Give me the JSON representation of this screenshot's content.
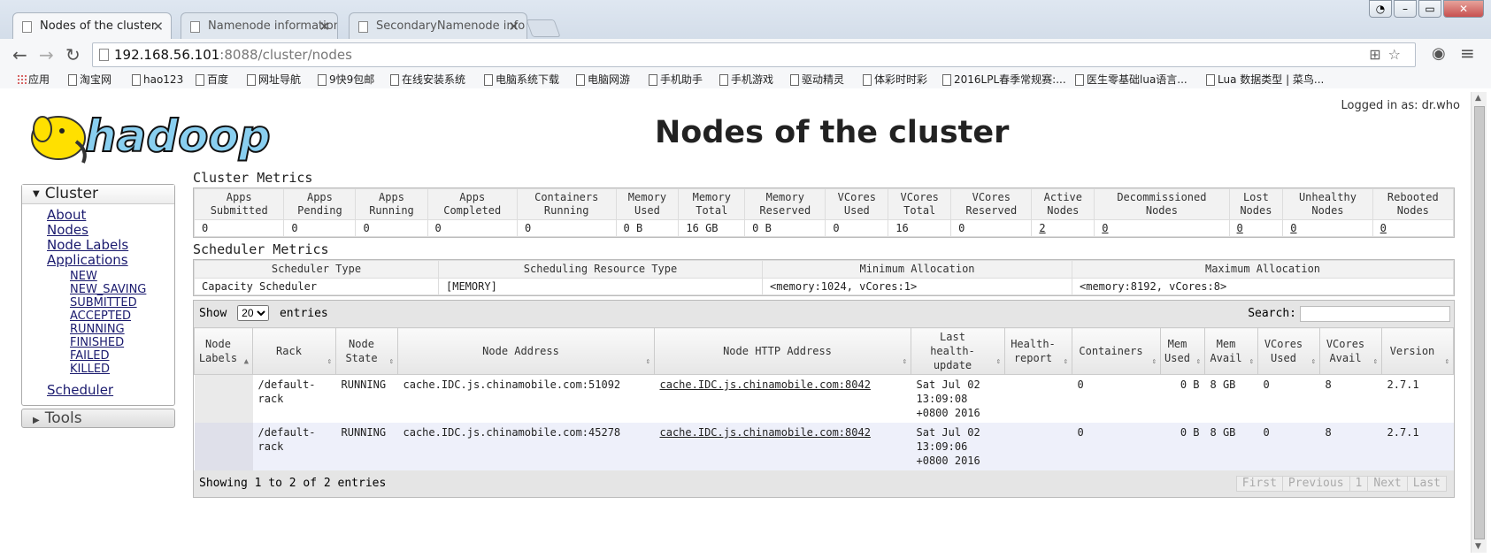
{
  "browser": {
    "tabs": [
      {
        "title": "Nodes of the cluster",
        "close": "✕"
      },
      {
        "title": "Namenode information",
        "close": "✕"
      },
      {
        "title": "SecondaryNamenode info",
        "close": "✕"
      }
    ],
    "url_host": "192.168.56.101",
    "url_path": ":8088/cluster/nodes",
    "bookmarks": [
      "应用",
      "淘宝网",
      "hao123",
      "百度",
      "网址导航",
      "9快9包邮",
      "在线安装系统",
      "电脑系统下载",
      "电脑网游",
      "手机助手",
      "手机游戏",
      "驱动精灵",
      "体彩时时彩",
      "2016LPL春季常规赛:...",
      "医生零基础lua语言...",
      "Lua 数据类型 | 菜鸟..."
    ]
  },
  "header": {
    "logo_text": "hadoop",
    "logged_in": "Logged in as: dr.who",
    "title": "Nodes of the cluster"
  },
  "nav": {
    "cluster_label": "Cluster",
    "items": [
      "About",
      "Nodes",
      "Node Labels",
      "Applications"
    ],
    "app_states": [
      "NEW",
      "NEW_SAVING",
      "SUBMITTED",
      "ACCEPTED",
      "RUNNING",
      "FINISHED",
      "FAILED",
      "KILLED"
    ],
    "scheduler": "Scheduler",
    "tools_label": "Tools"
  },
  "cluster_metrics": {
    "title": "Cluster Metrics",
    "headers": [
      [
        "Apps",
        "Submitted"
      ],
      [
        "Apps",
        "Pending"
      ],
      [
        "Apps",
        "Running"
      ],
      [
        "Apps",
        "Completed"
      ],
      [
        "Containers",
        "Running"
      ],
      [
        "Memory",
        "Used"
      ],
      [
        "Memory",
        "Total"
      ],
      [
        "Memory",
        "Reserved"
      ],
      [
        "VCores",
        "Used"
      ],
      [
        "VCores",
        "Total"
      ],
      [
        "VCores",
        "Reserved"
      ],
      [
        "Active",
        "Nodes"
      ],
      [
        "Decommissioned",
        "Nodes"
      ],
      [
        "Lost",
        "Nodes"
      ],
      [
        "Unhealthy",
        "Nodes"
      ],
      [
        "Rebooted",
        "Nodes"
      ]
    ],
    "values": [
      "0",
      "0",
      "0",
      "0",
      "0",
      "0 B",
      "16 GB",
      "0 B",
      "0",
      "16",
      "0",
      "2",
      "0",
      "0",
      "0",
      "0"
    ]
  },
  "scheduler_metrics": {
    "title": "Scheduler Metrics",
    "headers": [
      "Scheduler Type",
      "Scheduling Resource Type",
      "Minimum Allocation",
      "Maximum Allocation"
    ],
    "values": [
      "Capacity Scheduler",
      "[MEMORY]",
      "<memory:1024, vCores:1>",
      "<memory:8192, vCores:8>"
    ]
  },
  "nodes_table": {
    "show_label": "Show",
    "entries_value": "20",
    "entries_label": "entries",
    "search_label": "Search:",
    "headers": [
      [
        "Node",
        "Labels"
      ],
      [
        "Rack"
      ],
      [
        "Node",
        "State"
      ],
      [
        "Node Address"
      ],
      [
        "Node HTTP Address"
      ],
      [
        "Last health-",
        "update"
      ],
      [
        "Health-",
        "report"
      ],
      [
        "Containers"
      ],
      [
        "Mem",
        "Used"
      ],
      [
        "Mem",
        "Avail"
      ],
      [
        "VCores",
        "Used"
      ],
      [
        "VCores",
        "Avail"
      ],
      [
        "Version"
      ]
    ],
    "rows": [
      {
        "labels": "",
        "rack": [
          "/default-",
          "rack"
        ],
        "state": "RUNNING",
        "address": "cache.IDC.js.chinamobile.com:51092",
        "http": "cache.IDC.js.chinamobile.com:8042",
        "health": [
          "Sat Jul 02",
          "13:09:08",
          "+0800 2016"
        ],
        "report": "",
        "containers": "0",
        "mem_used": "0 B",
        "mem_avail": "8 GB",
        "vc_used": "0",
        "vc_avail": "8",
        "version": "2.7.1"
      },
      {
        "labels": "",
        "rack": [
          "/default-",
          "rack"
        ],
        "state": "RUNNING",
        "address": "cache.IDC.js.chinamobile.com:45278",
        "http": "cache.IDC.js.chinamobile.com:8042",
        "health": [
          "Sat Jul 02",
          "13:09:06",
          "+0800 2016"
        ],
        "report": "",
        "containers": "0",
        "mem_used": "0 B",
        "mem_avail": "8 GB",
        "vc_used": "0",
        "vc_avail": "8",
        "version": "2.7.1"
      }
    ],
    "info": "Showing 1 to 2 of 2 entries",
    "pager": [
      "First",
      "Previous",
      "1",
      "Next",
      "Last"
    ]
  }
}
